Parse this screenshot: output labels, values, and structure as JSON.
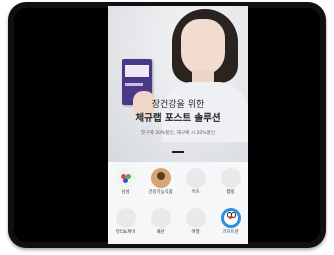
{
  "banner": {
    "headline_line1": "장건강을 위한",
    "headline_line2": "체규랩 포스트 솔루션",
    "subline": "첫구매 30%할인, 재구매 시 20%할인"
  },
  "categories": [
    {
      "label": "남성",
      "icon": "grapes-icon",
      "color": "#d94a5a"
    },
    {
      "label": "건강기능식품",
      "icon": "health-product-icon",
      "color": "#d7a574"
    },
    {
      "label": "키즈",
      "icon": "kids-icon",
      "color": "#e8e9eb"
    },
    {
      "label": "캠핑",
      "icon": "camping-icon",
      "color": "#e8e9eb"
    },
    {
      "label": "뷰티&케어",
      "icon": "beauty-icon",
      "color": "#e8e9eb"
    },
    {
      "label": "패션",
      "icon": "fashion-icon",
      "color": "#e8e9eb"
    },
    {
      "label": "여행",
      "icon": "travel-icon",
      "color": "#e8e9eb"
    },
    {
      "label": "기프트관",
      "icon": "doraemon-gift-icon",
      "color": "#2f8fd8"
    }
  ]
}
